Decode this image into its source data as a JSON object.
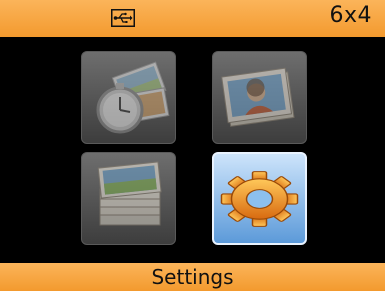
{
  "header": {
    "connection_icon": "usb-icon",
    "paper_size": "6x4"
  },
  "menu": {
    "items": [
      {
        "id": "slideshow",
        "icon": "slideshow-clock-icon",
        "selected": false
      },
      {
        "id": "photo",
        "icon": "photo-card-icon",
        "selected": false
      },
      {
        "id": "batch-print",
        "icon": "photo-stack-icon",
        "selected": false
      },
      {
        "id": "settings",
        "icon": "gear-icon",
        "selected": true
      }
    ]
  },
  "footer": {
    "label": "Settings"
  },
  "colors": {
    "bar": "#f39a2e",
    "background": "#000000",
    "selected_tile": "#5c9ad9",
    "gear": "#f08a1c"
  }
}
